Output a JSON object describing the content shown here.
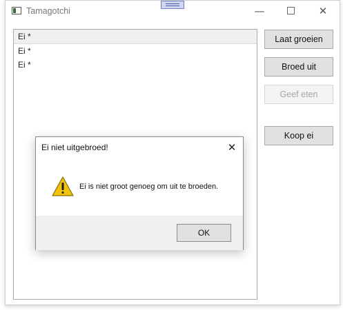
{
  "window": {
    "title": "Tamagotchi",
    "minimize_glyph": "—",
    "close_glyph": "✕"
  },
  "list": {
    "items": [
      "Ei *",
      "Ei *",
      "Ei *"
    ]
  },
  "buttons": {
    "grow": "Laat groeien",
    "hatch": "Broed uit",
    "feed": "Geef eten",
    "buy_egg": "Koop ei"
  },
  "dialog": {
    "title": "Ei niet uitgebroed!",
    "message": "Ei is niet groot genoeg om uit te broeden.",
    "ok_label": "OK",
    "close_glyph": "✕",
    "icon": "warning-icon"
  },
  "colors": {
    "warning_fill": "#f2c20d",
    "button_face": "#e1e1e1",
    "disabled_text": "#a5a5a5"
  }
}
